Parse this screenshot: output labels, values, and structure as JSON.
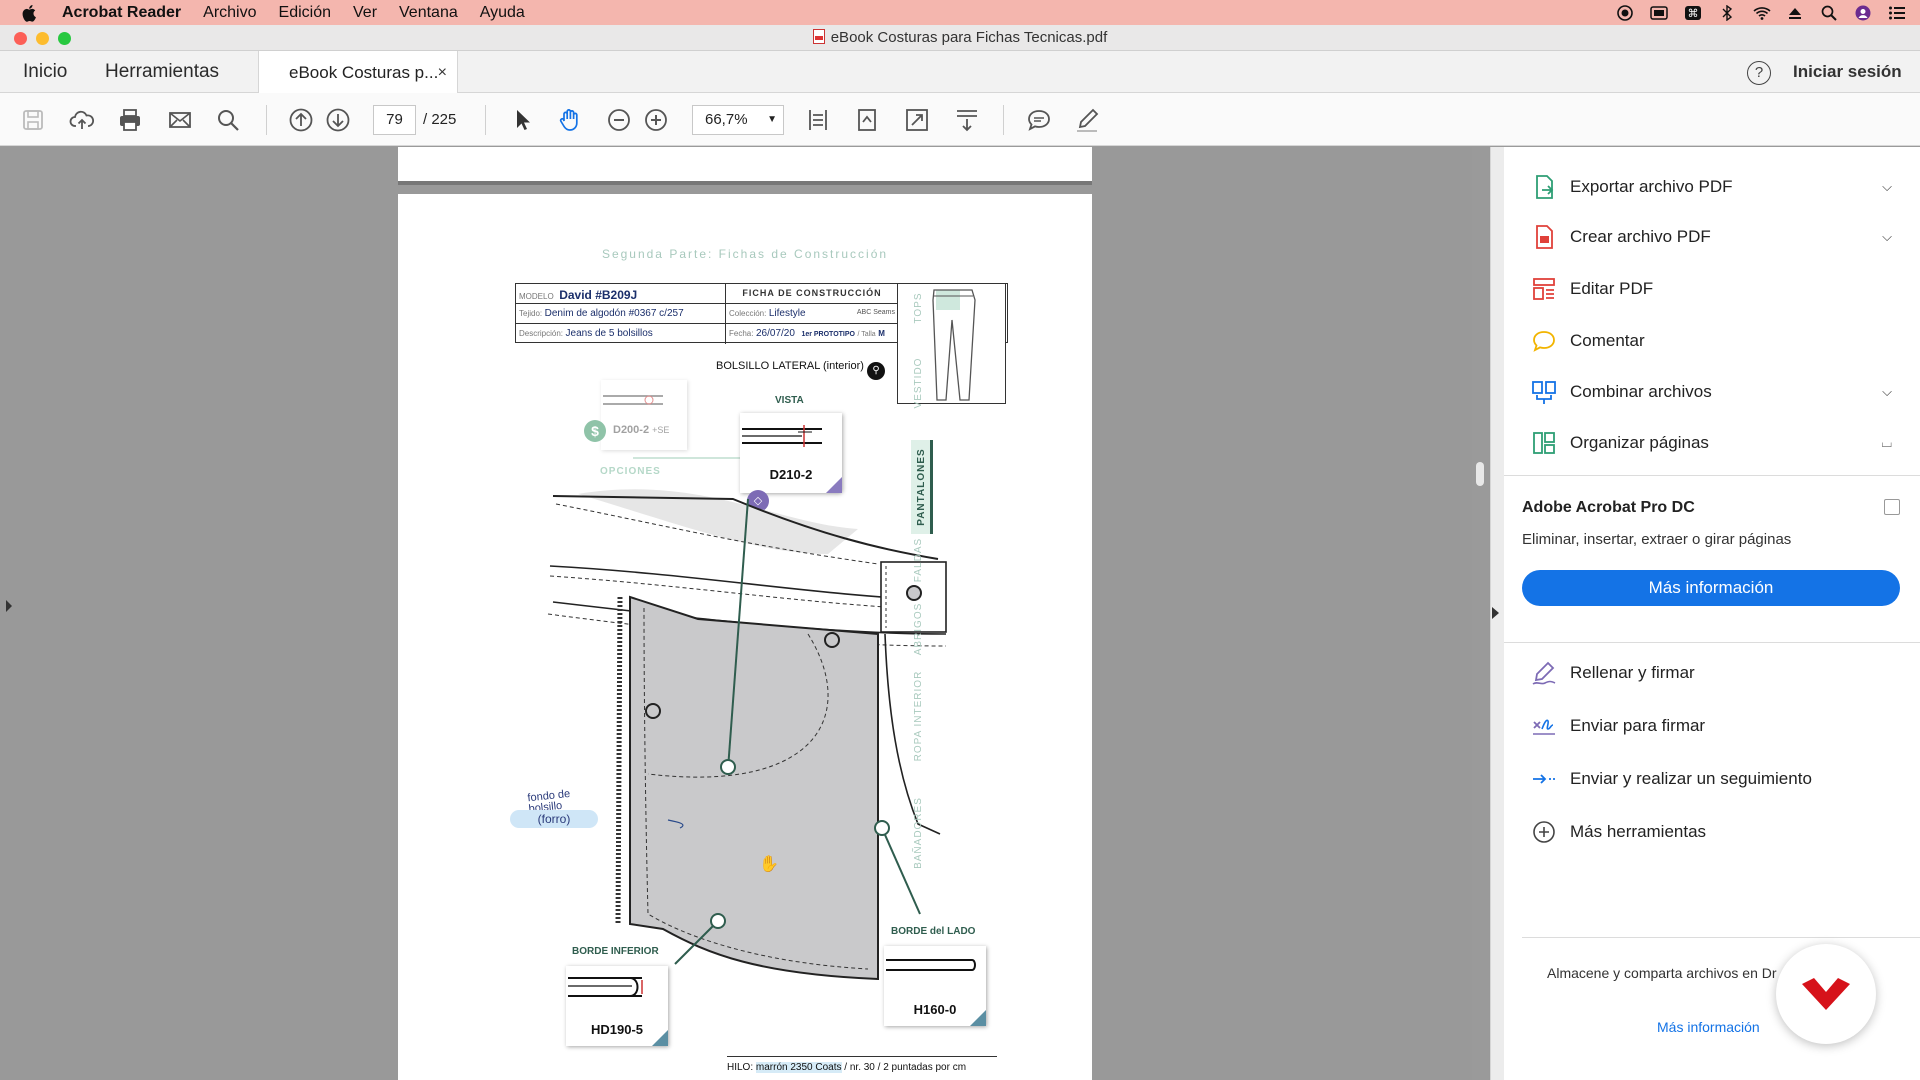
{
  "menubar": {
    "app_name": "Acrobat Reader",
    "items": [
      "Archivo",
      "Edición",
      "Ver",
      "Ventana",
      "Ayuda"
    ]
  },
  "window": {
    "title": "eBook Costuras para Fichas Tecnicas.pdf"
  },
  "tabs": {
    "home": "Inicio",
    "tools": "Herramientas",
    "document": "eBook Costuras p...",
    "close": "×",
    "help": "?",
    "signin": "Iniciar sesión"
  },
  "toolbar": {
    "page_current": "79",
    "page_total": "/ 225",
    "zoom": "66,7%"
  },
  "document": {
    "header": "Segunda Parte: Fichas de Construcción",
    "modelo_label": "MODELO",
    "modelo": "David #B209J",
    "ficha": "FICHA DE CONSTRUCCIÓN",
    "tejido_label": "Tejido:",
    "tejido": "Denim de algodón #0367 c/257",
    "coleccion_label": "Colección:",
    "coleccion": "Lifestyle",
    "brand": "ABC Seams",
    "descripcion_label": "Descripción:",
    "descripcion": "Jeans de 5 bolsillos",
    "fecha_label": "Fecha:",
    "fecha": "26/07/20",
    "prototipo": "1er PROTOTIPO",
    "talla_label": "/ Talla",
    "talla": "M",
    "section_title": "BOLSILLO LATERAL (interior)",
    "vista": "VISTA",
    "option_code": "D200-2",
    "option_extra": "+SE",
    "opciones": "OPCIONES",
    "main_code": "D210-2",
    "fondo": "fondo de bolsillo",
    "forro": "(forro)",
    "borde_inferior": "BORDE INFERIOR",
    "borde_inferior_code": "HD190-5",
    "borde_lado": "BORDE del LADO",
    "borde_lado_code": "H160-0",
    "hilo_label": "HILO:",
    "hilo": "marrón 2350 Coats",
    "hilo_extra": "/ nr. 30 / 2 puntadas por cm",
    "side_tabs": [
      "TOPS",
      "VESTIDO",
      "PANTALONES",
      "FALDAS",
      "ABRIGOS",
      "ROPA INTERIOR",
      "BAÑADORES"
    ],
    "active_tab": "PANTALONES"
  },
  "right_panel": {
    "items": [
      {
        "label": "Exportar archivo PDF",
        "icon": "export-pdf-icon",
        "color": "#2e9e74",
        "chevron": "down"
      },
      {
        "label": "Crear archivo PDF",
        "icon": "create-pdf-icon",
        "color": "#e0413a",
        "chevron": "down"
      },
      {
        "label": "Editar PDF",
        "icon": "edit-pdf-icon",
        "color": "#e0413a",
        "chevron": ""
      },
      {
        "label": "Comentar",
        "icon": "comment-icon",
        "color": "#f2b400",
        "chevron": ""
      },
      {
        "label": "Combinar archivos",
        "icon": "combine-files-icon",
        "color": "#1473e6",
        "chevron": "down"
      },
      {
        "label": "Organizar páginas",
        "icon": "organize-pages-icon",
        "color": "#2e9e74",
        "chevron": "up"
      }
    ],
    "pro_title": "Adobe Acrobat Pro DC",
    "pro_subtitle": "Eliminar, insertar, extraer o girar páginas",
    "pro_button": "Más información",
    "sign_items": [
      {
        "label": "Rellenar y firmar",
        "icon": "fill-sign-icon"
      },
      {
        "label": "Enviar para firmar",
        "icon": "send-sign-icon"
      },
      {
        "label": "Enviar y realizar un seguimiento",
        "icon": "send-track-icon"
      },
      {
        "label": "Más herramientas",
        "icon": "more-tools-icon"
      }
    ],
    "storage_text": "Almacene y comparta archivos en Dr",
    "storage_link": "Más información"
  },
  "colors": {
    "menubar": "#f4b6ae",
    "accent": "#1473e6",
    "doc_green": "#2f5d4e",
    "fab_red": "#d6121a"
  }
}
